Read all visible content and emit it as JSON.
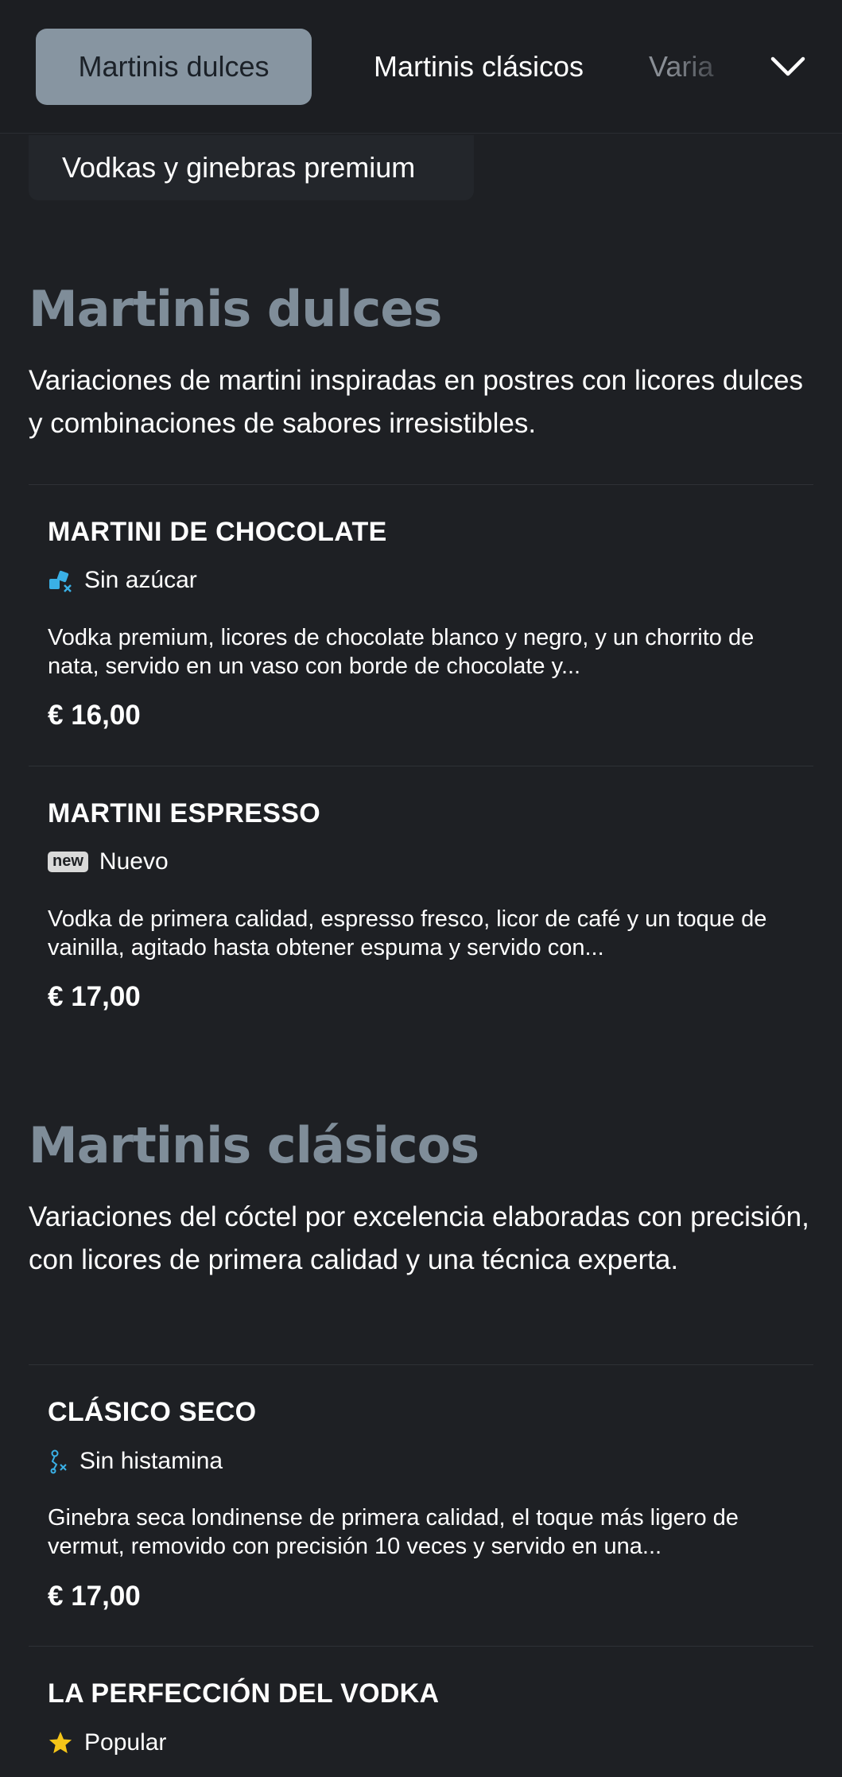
{
  "nav": {
    "tabs": [
      {
        "label": "Martinis dulces",
        "active": true
      },
      {
        "label": "Martinis clásicos",
        "active": false
      },
      {
        "label": "Varia",
        "active": false
      }
    ],
    "expand_icon": "chevron-down-icon",
    "overflow_tab": "Vodkas y ginebras premium"
  },
  "colors": {
    "background": "#1e2024",
    "accent": "#8795a1",
    "section_title": "#7f8d99",
    "tag_icon": "#3ab0e6",
    "star": "#f5c518"
  },
  "sections": [
    {
      "title": "Martinis dulces",
      "description": "Variaciones de martini inspiradas en postres con licores dulces y combinaciones de sabores irresistibles.",
      "items": [
        {
          "name": "MARTINI DE CHOCOLATE",
          "tag_icon": "sugar-free-icon",
          "tag": "Sin azúcar",
          "description": "Vodka premium, licores de chocolate blanco y negro, y un chorrito de nata, servido en un vaso con borde de chocolate y...",
          "price": "€ 16,00"
        },
        {
          "name": "MARTINI ESPRESSO",
          "tag_icon": "new-badge-icon",
          "tag_badge": "new",
          "tag": "Nuevo",
          "description": "Vodka de primera calidad, espresso fresco, licor de café y un toque de vainilla, agitado hasta obtener espuma y servido con...",
          "price": "€ 17,00"
        }
      ]
    },
    {
      "title": "Martinis clásicos",
      "description": "Variaciones del cóctel por excelencia elaboradas con precisión, con licores de primera calidad y una técnica experta.",
      "items": [
        {
          "name": "CLÁSICO SECO",
          "tag_icon": "histamine-free-icon",
          "tag": "Sin histamina",
          "description": "Ginebra seca londinense de primera calidad, el toque más ligero de vermut, removido con precisión 10 veces y servido en una...",
          "price": "€ 17,00"
        },
        {
          "name": "LA PERFECCIÓN DEL VODKA",
          "tag_icon": "star-icon",
          "tag": "Popular"
        }
      ]
    }
  ]
}
